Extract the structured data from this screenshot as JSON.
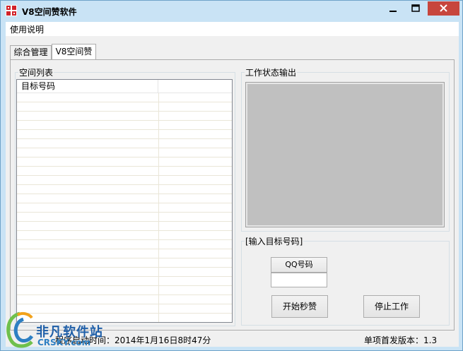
{
  "window": {
    "title": "V8空间赞软件",
    "colors": {
      "frame": "#c9e3f5",
      "close": "#c7463d",
      "output_bg": "#c0c0c0"
    }
  },
  "menu": {
    "items": [
      "使用说明"
    ]
  },
  "tabs": [
    {
      "label": "综合管理",
      "active": false
    },
    {
      "label": "V8空间赞",
      "active": true
    }
  ],
  "space_list": {
    "legend": "空间列表",
    "columns": [
      "目标号码",
      ""
    ],
    "rows": []
  },
  "output": {
    "legend": "工作状态输出"
  },
  "input_group": {
    "legend": "[输入目标号码]",
    "qq_label": "QQ号码",
    "qq_value": ""
  },
  "buttons": {
    "start": "开始秒赞",
    "stop": "停止工作"
  },
  "status": {
    "left": "程序启动时间：2014年1月16日8时47分",
    "right": "单项首发版本：1.3"
  },
  "watermark": {
    "text": "非凡软件站",
    "sub": "CRSKY.com"
  }
}
